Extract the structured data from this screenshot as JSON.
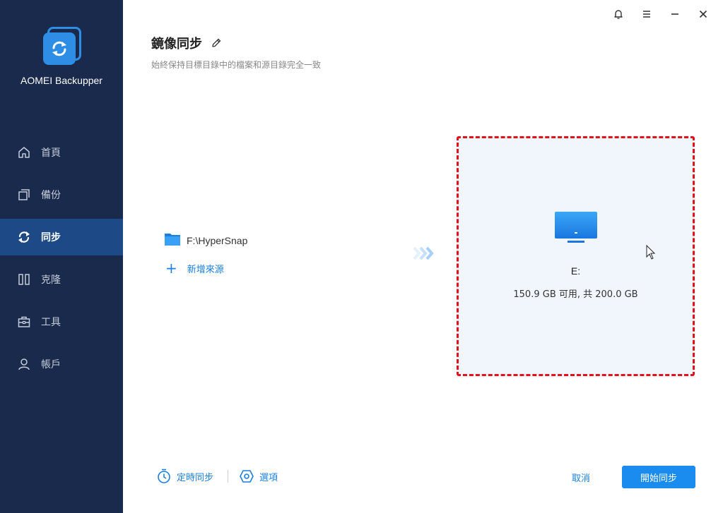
{
  "app": {
    "name": "AOMEI Backupper",
    "accent": "#1a8cf0",
    "sidebar_bg": "#1a2a4c",
    "active_bg": "#1d4a86"
  },
  "sidebar": {
    "items": [
      {
        "label": "首頁",
        "icon": "home-icon"
      },
      {
        "label": "備份",
        "icon": "copy-icon"
      },
      {
        "label": "同步",
        "icon": "sync-icon",
        "active": true
      },
      {
        "label": "克隆",
        "icon": "clone-icon"
      },
      {
        "label": "工具",
        "icon": "toolbox-icon"
      },
      {
        "label": "帳戶",
        "icon": "user-icon"
      }
    ]
  },
  "window_controls": [
    "bell-icon",
    "menu-icon",
    "minimize-icon",
    "close-icon"
  ],
  "header": {
    "title": "鏡像同步",
    "subtitle": "始終保持目標目錄中的檔案和源目錄完全一致"
  },
  "source": {
    "path": "F:\\HyperSnap",
    "add_label": "新增來源"
  },
  "destination": {
    "drive": "E:",
    "space": "150.9 GB 可用, 共 200.0 GB",
    "border_color": "#e0121b"
  },
  "footer": {
    "schedule_label": "定時同步",
    "options_label": "選項",
    "cancel_label": "取消",
    "start_label": "開始同步"
  }
}
